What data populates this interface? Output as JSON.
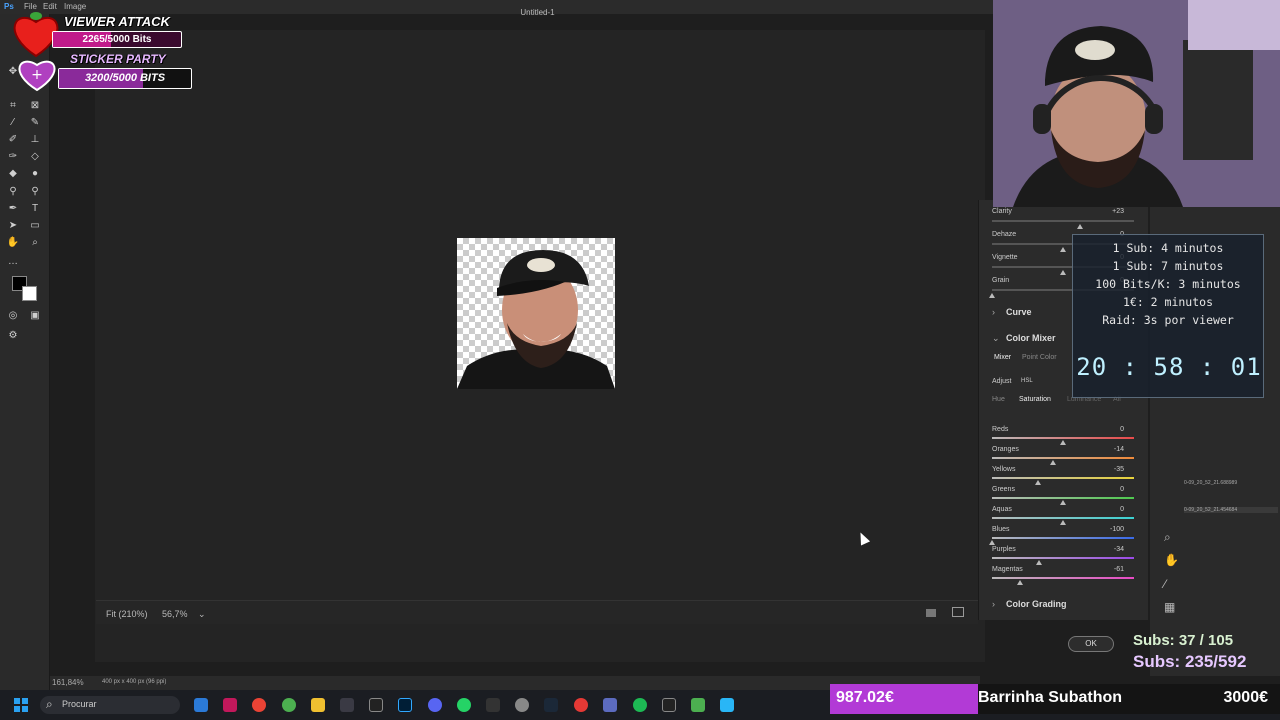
{
  "menu": {
    "file": "File",
    "edit": "Edit",
    "image": "Image"
  },
  "camera_raw": {
    "title": "Untitled-1",
    "status": {
      "fit": "Fit (210%)",
      "zoom": "56,7%"
    },
    "image_info": "400 px x 400 px (96 ppi)",
    "ps_zoom": "161,84%",
    "ok_label": "OK",
    "effects": [
      {
        "label": "Clarity",
        "value": "+23",
        "level": 0.62
      },
      {
        "label": "Dehaze",
        "value": "0",
        "level": 0.5
      },
      {
        "label": "Vignette",
        "value": "0",
        "level": 0.5
      },
      {
        "label": "Grain",
        "value": "0",
        "level": 0.0
      }
    ],
    "curve_label": "Curve",
    "color_mixer": {
      "title": "Color Mixer",
      "tabs": [
        "Mixer",
        "Point Color"
      ],
      "adjust_label": "Adjust",
      "adjust_value": "HSL",
      "subtabs": [
        "Hue",
        "Saturation",
        "Luminance",
        "All"
      ],
      "rows": [
        {
          "label": "Reds",
          "value": "0",
          "level": 0.5,
          "gradient": "#bbbbbb,#e84a4a"
        },
        {
          "label": "Oranges",
          "value": "-14",
          "level": 0.43,
          "gradient": "#bbbbbb,#ef8a3a"
        },
        {
          "label": "Yellows",
          "value": "-35",
          "level": 0.325,
          "gradient": "#bbbbbb,#e8d23a"
        },
        {
          "label": "Greens",
          "value": "0",
          "level": 0.5,
          "gradient": "#bbbbbb,#4ec94e"
        },
        {
          "label": "Aquas",
          "value": "0",
          "level": 0.5,
          "gradient": "#bbbbbb,#3ad2d2"
        },
        {
          "label": "Blues",
          "value": "-100",
          "level": 0.0,
          "gradient": "#bbbbbb,#3a6ae8"
        },
        {
          "label": "Purples",
          "value": "-34",
          "level": 0.33,
          "gradient": "#bbbbbb,#9a4ae8"
        },
        {
          "label": "Magentas",
          "value": "-61",
          "level": 0.195,
          "gradient": "#bbbbbb,#e84ac4"
        }
      ]
    },
    "color_grading_label": "Color Grading"
  },
  "layer_names": [
    "0-09_20_52_21.688989",
    "0-09_20_52_21.454684"
  ],
  "overlay": {
    "viewer_attack": {
      "title": "VIEWER ATTACK",
      "bits": "2265/5000 Bits",
      "level": 0.453
    },
    "sticker_party": {
      "title": "STICKER PARTY",
      "bits": "3200/5000 BITS",
      "level": 0.64
    },
    "timer_rules": [
      "1 Sub: 4 minutos",
      "1 Sub: 7 minutos",
      "100 Bits/K: 3 minutos",
      "1€: 2 minutos",
      "Raid: 3s por viewer"
    ],
    "timer": "20 : 58 : 01",
    "subs1": "Subs: 37 / 105",
    "subs2": "Subs: 235/592",
    "subathon_amount": "987.02€",
    "subathon_label": "Barrinha Subathon",
    "subathon_goal": "3000€",
    "subathon_level": 0.329
  },
  "taskbar": {
    "search": "Procurar"
  }
}
